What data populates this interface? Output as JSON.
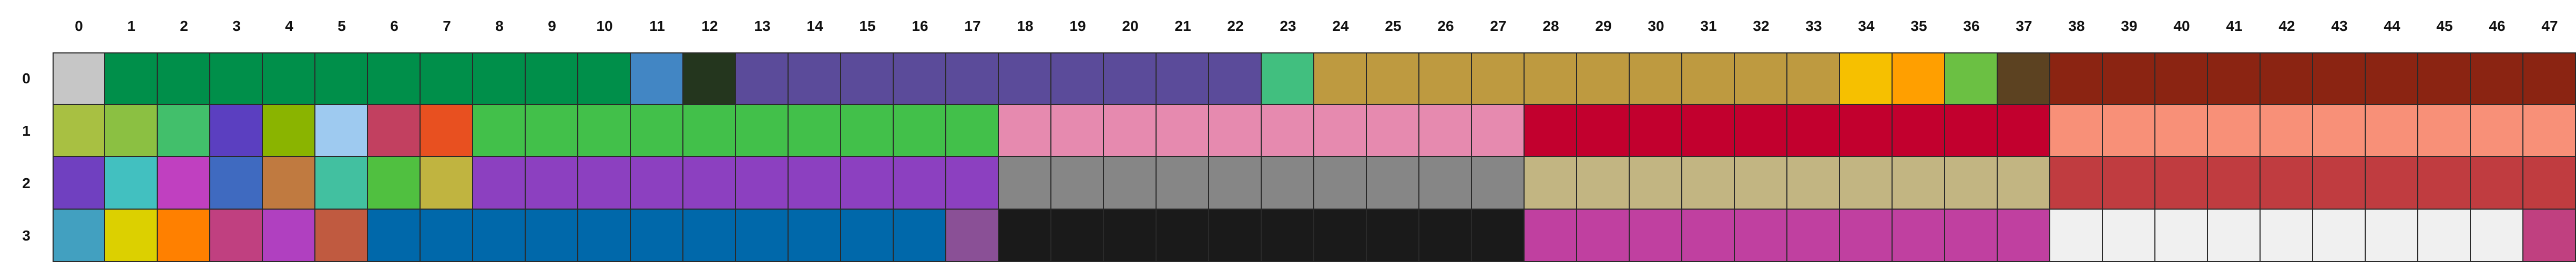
{
  "columns": [
    "0",
    "1",
    "2",
    "3",
    "4",
    "5",
    "6",
    "7",
    "8",
    "9",
    "10",
    "11",
    "12",
    "13",
    "14",
    "15",
    "16",
    "17",
    "18",
    "19",
    "20",
    "21",
    "22",
    "23",
    "24",
    "25",
    "26",
    "27",
    "28",
    "29",
    "30",
    "31",
    "32",
    "33",
    "34",
    "35",
    "36",
    "37",
    "38",
    "39",
    "40",
    "41",
    "42",
    "43",
    "44",
    "45",
    "46",
    "47"
  ],
  "rows": [
    {
      "label": "0",
      "cells": [
        "#c6c6c6",
        "#008f4a",
        "#008f4a",
        "#008f4a",
        "#008f4a",
        "#008f4a",
        "#008f4a",
        "#008f4a",
        "#008f4a",
        "#008f4a",
        "#008f4a",
        "#4286c4",
        "#24361e",
        "#5b4b9a",
        "#5b4b9a",
        "#5b4b9a",
        "#5b4b9a",
        "#5b4b9a",
        "#5b4b9a",
        "#5b4b9a",
        "#5b4b9a",
        "#5b4b9a",
        "#5b4b9a",
        "#41bf7f",
        "#be9a40",
        "#be9a40",
        "#be9a40",
        "#be9a40",
        "#be9a40",
        "#be9a40",
        "#be9a40",
        "#be9a40",
        "#be9a40",
        "#be9a40",
        "#f6c000",
        "#ff9f00",
        "#6bc043",
        "#5c4221",
        "#8b2412",
        "#8b2412",
        "#8b2412",
        "#8b2412",
        "#8b2412",
        "#8b2412",
        "#8b2412",
        "#8b2412",
        "#8b2412",
        "#8b2412"
      ]
    },
    {
      "label": "1",
      "cells": [
        "#a8c042",
        "#8bc042",
        "#42bf6b",
        "#5b3fc0",
        "#8ab400",
        "#9ecaf0",
        "#c24060",
        "#e85020",
        "#42c04a",
        "#42c04a",
        "#42c04a",
        "#42c04a",
        "#42c04a",
        "#42c04a",
        "#42c04a",
        "#42c04a",
        "#42c04a",
        "#42c04a",
        "#e68aaf",
        "#e68aaf",
        "#e68aaf",
        "#e68aaf",
        "#e68aaf",
        "#e68aaf",
        "#e68aaf",
        "#e68aaf",
        "#e68aaf",
        "#e68aaf",
        "#c2002e",
        "#c2002e",
        "#c2002e",
        "#c2002e",
        "#c2002e",
        "#c2002e",
        "#c2002e",
        "#c2002e",
        "#c2002e",
        "#c2002e",
        "#f89078",
        "#f89078",
        "#f89078",
        "#f89078",
        "#f89078",
        "#f89078",
        "#f89078",
        "#f89078",
        "#f89078",
        "#f89078"
      ]
    },
    {
      "label": "2",
      "cells": [
        "#7040c0",
        "#42c0c0",
        "#c040c0",
        "#3f6ac0",
        "#c07a40",
        "#42c0a0",
        "#50c040",
        "#c0b440",
        "#8c40c0",
        "#8c40c0",
        "#8c40c0",
        "#8c40c0",
        "#8c40c0",
        "#8c40c0",
        "#8c40c0",
        "#8c40c0",
        "#8c40c0",
        "#8c40c0",
        "#868686",
        "#868686",
        "#868686",
        "#868686",
        "#868686",
        "#868686",
        "#868686",
        "#868686",
        "#868686",
        "#868686",
        "#c2b582",
        "#c2b582",
        "#c2b582",
        "#c2b582",
        "#c2b582",
        "#c2b582",
        "#c2b582",
        "#c2b582",
        "#c2b582",
        "#c2b582",
        "#c03c40",
        "#c03c40",
        "#c03c40",
        "#c03c40",
        "#c03c40",
        "#c03c40",
        "#c03c40",
        "#c03c40",
        "#c03c40",
        "#c03c40"
      ]
    },
    {
      "label": "3",
      "cells": [
        "#42a0c0",
        "#dcd000",
        "#ff8000",
        "#c04080",
        "#b040c0",
        "#c05a40",
        "#0068aa",
        "#0068aa",
        "#0068aa",
        "#0068aa",
        "#0068aa",
        "#0068aa",
        "#0068aa",
        "#0068aa",
        "#0068aa",
        "#0068aa",
        "#0068aa",
        "#8a5096",
        "#1a1a1a",
        "#1a1a1a",
        "#1a1a1a",
        "#1a1a1a",
        "#1a1a1a",
        "#1a1a1a",
        "#1a1a1a",
        "#1a1a1a",
        "#1a1a1a",
        "#1a1a1a",
        "#c040a0",
        "#c040a0",
        "#c040a0",
        "#c040a0",
        "#c040a0",
        "#c040a0",
        "#c040a0",
        "#c040a0",
        "#c040a0",
        "#c040a0",
        "#f0f0f0",
        "#f0f0f0",
        "#f0f0f0",
        "#f0f0f0",
        "#f0f0f0",
        "#f0f0f0",
        "#f0f0f0",
        "#f0f0f0",
        "#f0f0f0",
        "#c04080"
      ]
    }
  ]
}
